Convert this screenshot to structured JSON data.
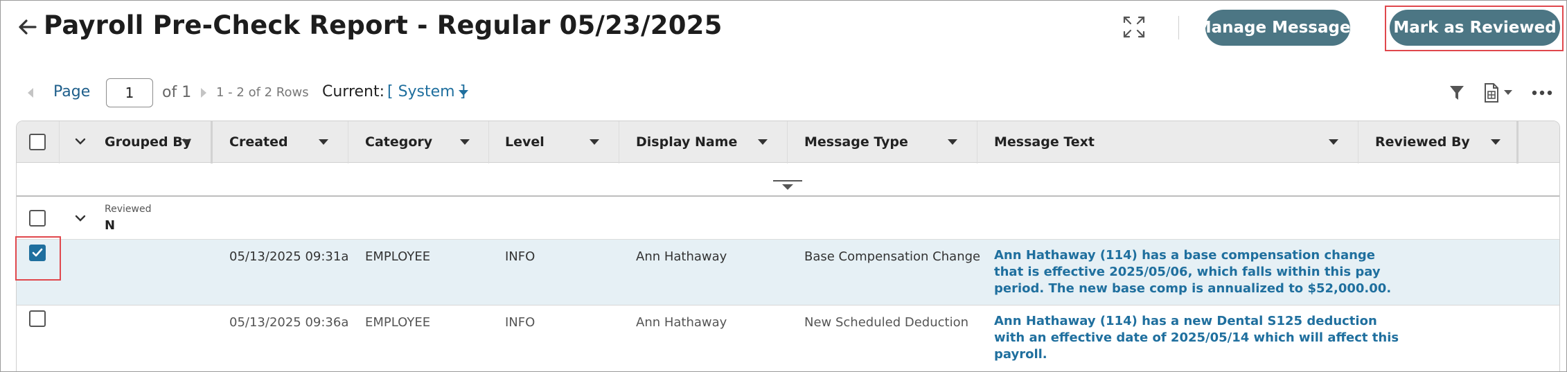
{
  "header": {
    "title": "Payroll Pre-Check Report - Regular 05/23/2025",
    "manage_messages_label": "Manage Messages",
    "mark_reviewed_label": "Mark as Reviewed"
  },
  "pager": {
    "page_label": "Page",
    "page_value": "1",
    "of_label": "of 1",
    "rows_label": "1 - 2 of 2 Rows",
    "current_label": "Current:",
    "current_value": "[ System ]"
  },
  "grid": {
    "columns": [
      {
        "label": "Grouped By"
      },
      {
        "label": "Created"
      },
      {
        "label": "Category"
      },
      {
        "label": "Level"
      },
      {
        "label": "Display Name"
      },
      {
        "label": "Message Type"
      },
      {
        "label": "Message Text"
      },
      {
        "label": "Reviewed By"
      }
    ],
    "group": {
      "field": "Reviewed",
      "value": "N"
    },
    "rows": [
      {
        "checked": true,
        "created": "05/13/2025 09:31a",
        "category": "EMPLOYEE",
        "level": "INFO",
        "display_name": "Ann Hathaway",
        "message_type": "Base Compensation Change",
        "message_lines": [
          "Ann Hathaway (114) has a base compensation change",
          "that is effective 2025/05/06, which falls within this pay",
          "period. The new base comp is annualized to $52,000.00."
        ],
        "reviewed_by": ""
      },
      {
        "checked": false,
        "created": "05/13/2025 09:36a",
        "category": "EMPLOYEE",
        "level": "INFO",
        "display_name": "Ann Hathaway",
        "message_type": "New Scheduled Deduction",
        "message_lines": [
          "Ann Hathaway (114) has a new Dental S125 deduction",
          "with an effective date of 2025/05/14 which will affect this",
          "payroll."
        ],
        "reviewed_by": ""
      }
    ]
  },
  "icons": [
    "back-arrow-icon",
    "expand-icon",
    "filter-icon",
    "export-icon",
    "more-icon",
    "chevron-down-icon",
    "checkmark-icon"
  ],
  "colors": {
    "accent": "#4c7684",
    "link": "#1f6f9e",
    "highlight": "#e0474c",
    "selected_row": "#e6f0f5",
    "header_bg": "#ebebeb"
  }
}
